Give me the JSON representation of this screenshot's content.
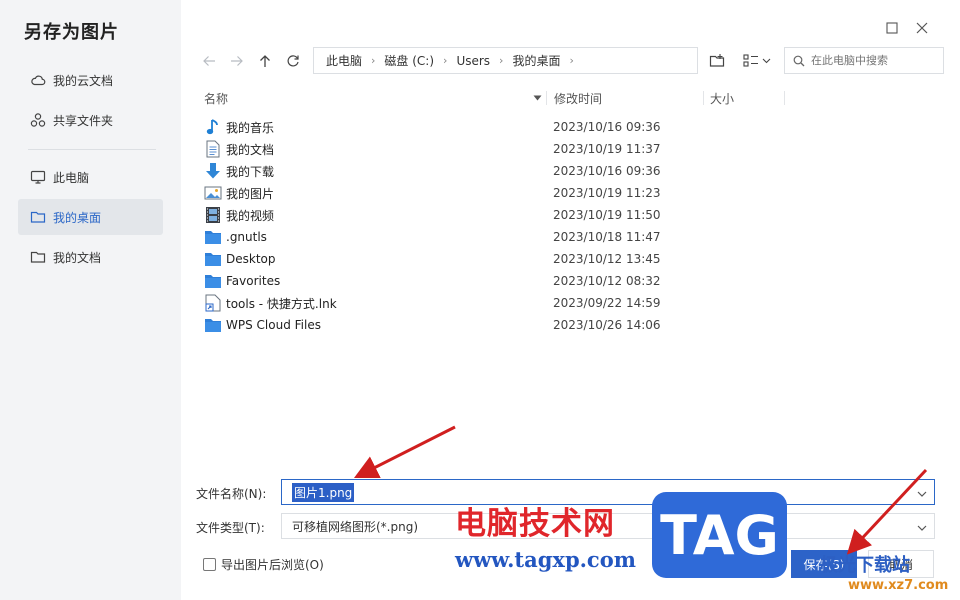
{
  "dialog": {
    "title": "另存为图片"
  },
  "sidebar": {
    "items": [
      {
        "label": "我的云文档",
        "icon": "cloud-icon"
      },
      {
        "label": "共享文件夹",
        "icon": "share-icon"
      },
      {
        "label": "此电脑",
        "icon": "monitor-icon"
      },
      {
        "label": "我的桌面",
        "icon": "folder-icon",
        "active": true
      },
      {
        "label": "我的文档",
        "icon": "folder-icon"
      }
    ]
  },
  "breadcrumb": [
    "此电脑",
    "磁盘 (C:)",
    "Users",
    "我的桌面"
  ],
  "search": {
    "placeholder": "在此电脑中搜索"
  },
  "columns": {
    "name": "名称",
    "modified": "修改时间",
    "size": "大小"
  },
  "files": [
    {
      "name": "我的音乐",
      "date": "2023/10/16 09:36",
      "icon": "music-note-icon"
    },
    {
      "name": "我的文档",
      "date": "2023/10/19 11:37",
      "icon": "document-icon"
    },
    {
      "name": "我的下载",
      "date": "2023/10/16 09:36",
      "icon": "download-arrow-icon"
    },
    {
      "name": "我的图片",
      "date": "2023/10/19 11:23",
      "icon": "picture-icon"
    },
    {
      "name": "我的视频",
      "date": "2023/10/19 11:50",
      "icon": "film-icon"
    },
    {
      "name": ".gnutls",
      "date": "2023/10/18 11:47",
      "icon": "folder-icon"
    },
    {
      "name": "Desktop",
      "date": "2023/10/12 13:45",
      "icon": "folder-icon"
    },
    {
      "name": "Favorites",
      "date": "2023/10/12 08:32",
      "icon": "folder-icon"
    },
    {
      "name": "tools - 快捷方式.lnk",
      "date": "2023/09/22 14:59",
      "icon": "shortcut-icon"
    },
    {
      "name": "WPS Cloud Files",
      "date": "2023/10/26 14:06",
      "icon": "folder-icon"
    }
  ],
  "form": {
    "filename_label": "文件名称(N):",
    "filename_value": "图片1.png",
    "filetype_label": "文件类型(T):",
    "filetype_value": "可移植网络图形(*.png)",
    "browse_checkbox": "导出图片后浏览(O)",
    "save": "保存(S)",
    "cancel": "取消"
  },
  "watermark": {
    "cn": "电脑技术网",
    "url": "www.tagxp.com",
    "tag": "TAG",
    "site": "极光下载站",
    "site2": "www.xz7.com"
  },
  "colors": {
    "accent": "#2d63c8",
    "arrow": "#d01f1f",
    "sidebar_bg": "#f3f4f6"
  }
}
